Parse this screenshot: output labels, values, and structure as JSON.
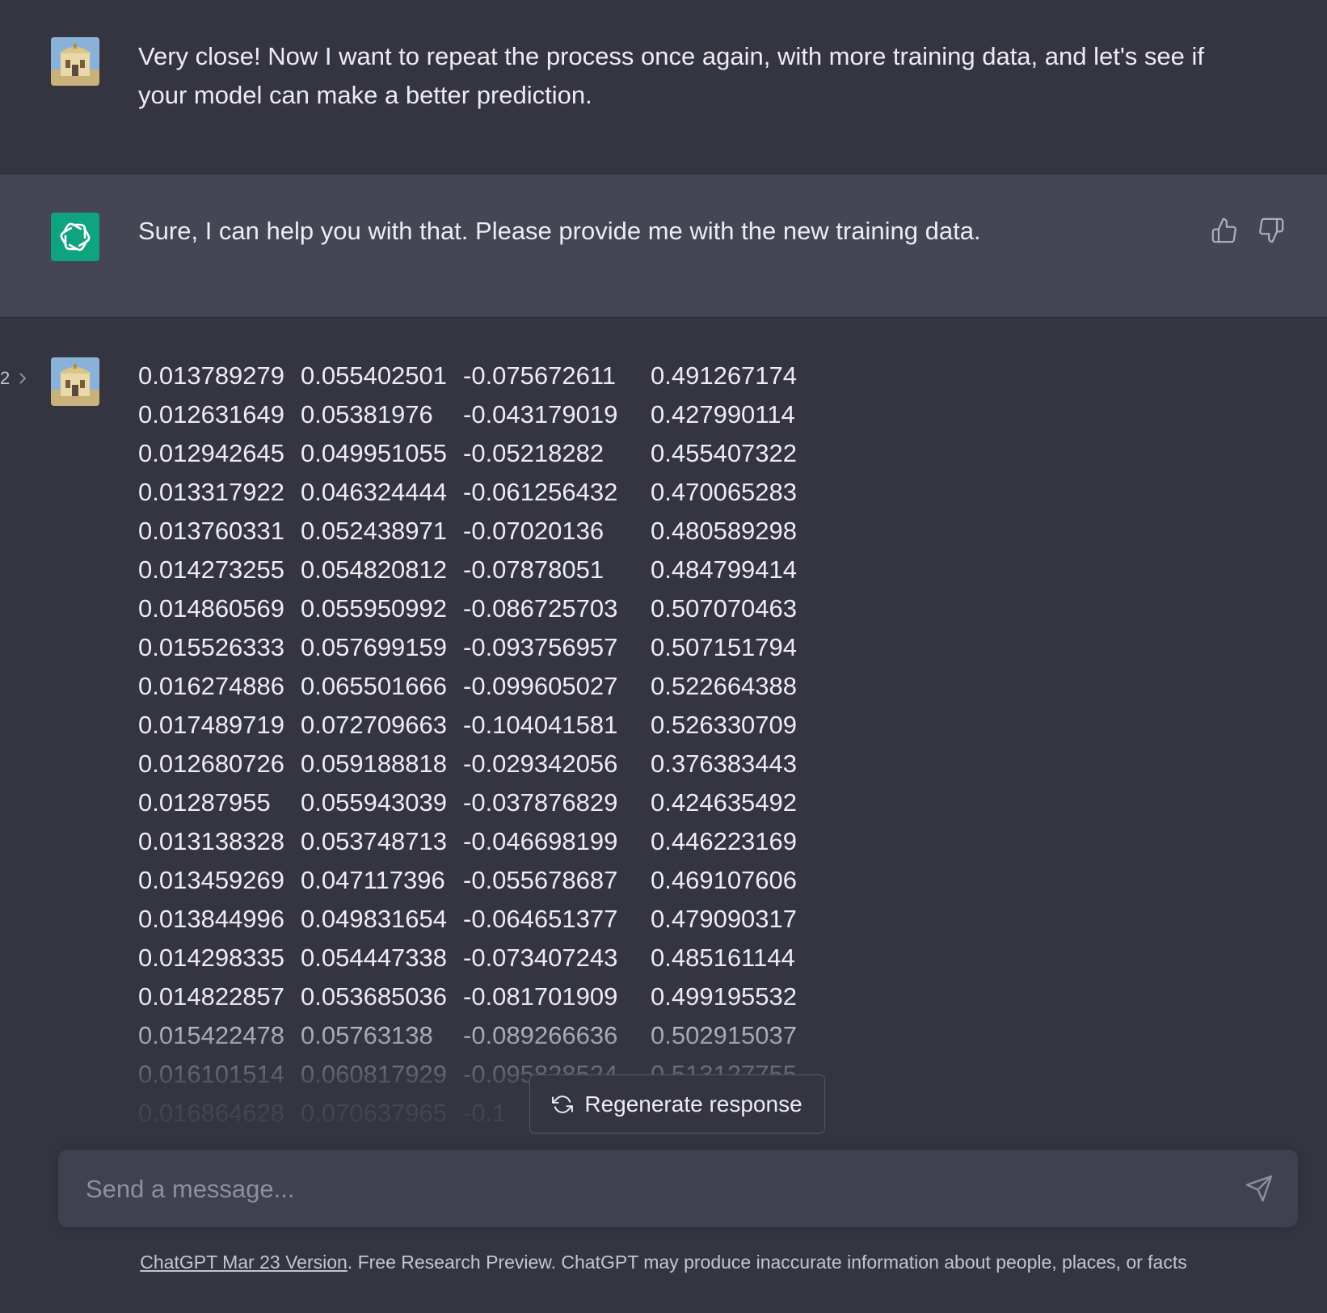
{
  "conversation": {
    "user_message_1": "Very close! Now I want to repeat the process once again, with more training data, and let's see if your model can make a better prediction.",
    "assistant_message": "Sure, I can help you with that. Please provide me with the new training data.",
    "pager": {
      "label": "2",
      "icon": "chevron-right-icon"
    },
    "data_rows": [
      [
        "0.013789279",
        "0.055402501",
        "-0.075672611",
        "0.491267174"
      ],
      [
        "0.012631649",
        "0.05381976",
        "-0.043179019",
        "0.427990114"
      ],
      [
        "0.012942645",
        "0.049951055",
        "-0.05218282",
        "0.455407322"
      ],
      [
        "0.013317922",
        "0.046324444",
        "-0.061256432",
        "0.470065283"
      ],
      [
        "0.013760331",
        "0.052438971",
        "-0.07020136",
        "0.480589298"
      ],
      [
        "0.014273255",
        "0.054820812",
        "-0.07878051",
        "0.484799414"
      ],
      [
        "0.014860569",
        "0.055950992",
        "-0.086725703",
        "0.507070463"
      ],
      [
        "0.015526333",
        "0.057699159",
        "-0.093756957",
        "0.507151794"
      ],
      [
        "0.016274886",
        "0.065501666",
        "-0.099605027",
        "0.522664388"
      ],
      [
        "0.017489719",
        "0.072709663",
        "-0.104041581",
        "0.526330709"
      ],
      [
        "0.012680726",
        "0.059188818",
        "-0.029342056",
        "0.376383443"
      ],
      [
        "0.01287955",
        "0.055943039",
        "-0.037876829",
        "0.424635492"
      ],
      [
        "0.013138328",
        "0.053748713",
        "-0.046698199",
        "0.446223169"
      ],
      [
        "0.013459269",
        "0.047117396",
        "-0.055678687",
        "0.469107606"
      ],
      [
        "0.013844996",
        "0.049831654",
        "-0.064651377",
        "0.479090317"
      ],
      [
        "0.014298335",
        "0.054447338",
        "-0.073407243",
        "0.485161144"
      ],
      [
        "0.014822857",
        "0.053685036",
        "-0.081701909",
        "0.499195532"
      ],
      [
        "0.015422478",
        "0.05763138",
        "-0.089266636",
        "0.502915037"
      ],
      [
        "0.016101514",
        "0.060817929",
        "-0.095828524",
        "0.513127755"
      ],
      [
        "0.016864628",
        "0.070637965",
        "-0.1",
        ""
      ]
    ]
  },
  "regenerate": {
    "label": "Regenerate response",
    "icon": "refresh-icon"
  },
  "composer": {
    "placeholder": "Send a message...",
    "send_icon": "send-icon"
  },
  "footer": {
    "link_text": "ChatGPT Mar 23 Version",
    "text": ". Free Research Preview. ChatGPT may produce inaccurate information about people, places, or facts"
  },
  "colors": {
    "background": "#343541",
    "assistant_background": "#444654",
    "composer_background": "#40414f",
    "gpt_avatar": "#10a37f",
    "text": "#ececf1"
  }
}
